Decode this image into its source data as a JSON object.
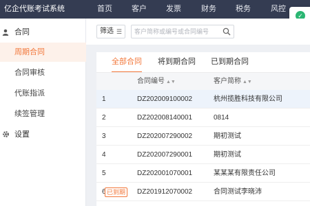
{
  "app_title": "亿企代账考试系统",
  "nav": [
    "首页",
    "客户",
    "发票",
    "财务",
    "税务",
    "风控"
  ],
  "sidebar": {
    "group_contract": "合同",
    "items": [
      "周期合同",
      "合同审核",
      "代账指派",
      "续签管理"
    ],
    "group_settings": "设置"
  },
  "filter": {
    "button_label": "筛选",
    "search_placeholder": "客户简称或编号或合同编号"
  },
  "tabs": [
    "全部合同",
    "将到期合同",
    "已到期合同"
  ],
  "table": {
    "columns": [
      "合同编号",
      "客户简称"
    ],
    "rows": [
      {
        "no": "1",
        "contract": "DZ202009100002",
        "client": "杭州揽胜科技有限公司"
      },
      {
        "no": "2",
        "contract": "DZ202008140001",
        "client": "0814"
      },
      {
        "no": "3",
        "contract": "DZ202007290002",
        "client": "期初测试"
      },
      {
        "no": "4",
        "contract": "DZ202007290001",
        "client": "期初测试"
      },
      {
        "no": "5",
        "contract": "DZ202001070001",
        "client": "某某某有限责任公司"
      },
      {
        "no": "6",
        "tag": "已到期",
        "contract": "DZ201912070002",
        "client": "合同测试李晓沛"
      }
    ]
  },
  "colors": {
    "topbar": "#343c52",
    "accent": "#f2773a",
    "selected_row": "#edf3fb",
    "success": "#2bb673"
  },
  "icons": {
    "contract_group": "user-icon",
    "settings_group": "gear-icon",
    "filter": "list-icon",
    "search": "search-icon",
    "toast": "check-circle-icon",
    "sort": "sort-icon"
  }
}
